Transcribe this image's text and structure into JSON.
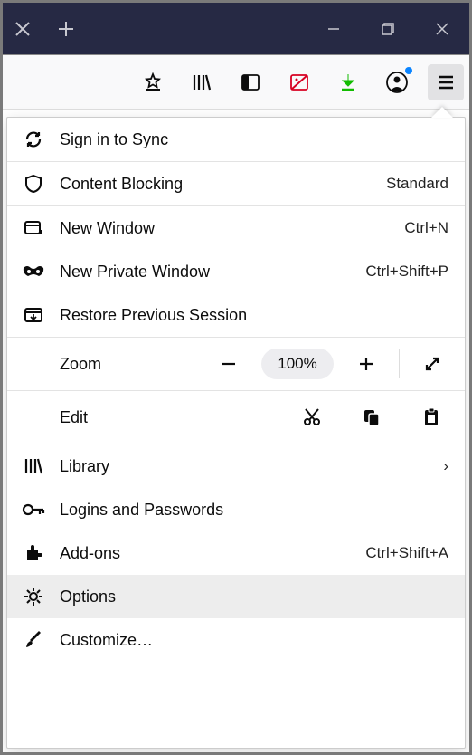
{
  "menu": {
    "sync": "Sign in to Sync",
    "blocking": {
      "label": "Content Blocking",
      "value": "Standard"
    },
    "new_window": {
      "label": "New Window",
      "shortcut": "Ctrl+N"
    },
    "private_window": {
      "label": "New Private Window",
      "shortcut": "Ctrl+Shift+P"
    },
    "restore": "Restore Previous Session",
    "zoom": {
      "label": "Zoom",
      "value": "100%"
    },
    "edit": {
      "label": "Edit"
    },
    "library": "Library",
    "logins": "Logins and Passwords",
    "addons": {
      "label": "Add-ons",
      "shortcut": "Ctrl+Shift+A"
    },
    "options": "Options",
    "customize": "Customize…"
  }
}
